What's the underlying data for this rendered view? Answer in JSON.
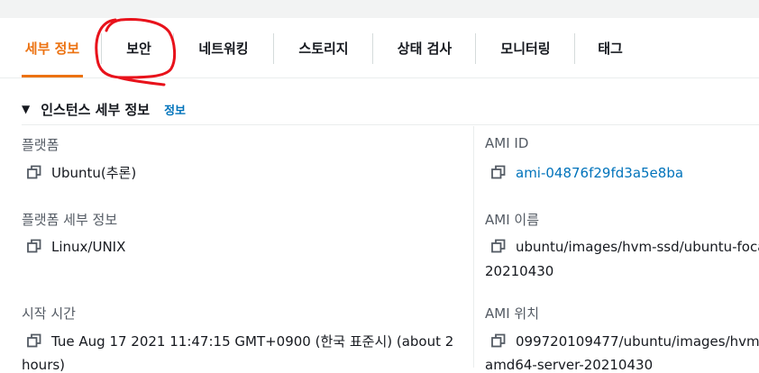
{
  "tabs": [
    {
      "label": "세부 정보",
      "active": true
    },
    {
      "label": "보안",
      "active": false
    },
    {
      "label": "네트워킹",
      "active": false
    },
    {
      "label": "스토리지",
      "active": false
    },
    {
      "label": "상태 검사",
      "active": false
    },
    {
      "label": "모니터링",
      "active": false
    },
    {
      "label": "태그",
      "active": false
    }
  ],
  "section": {
    "caret": "▼",
    "title": "인스턴스 세부 정보",
    "info_link": "정보"
  },
  "left_fields": {
    "platform": {
      "label": "플랫폼",
      "value": "Ubuntu(추론)"
    },
    "platform_details": {
      "label": "플랫폼 세부 정보",
      "value": "Linux/UNIX"
    },
    "launch_time": {
      "label": "시작 시간",
      "value": "Tue Aug 17 2021 11:47:15 GMT+0900 (한국 표준시) (about 2",
      "value_cont": "hours)"
    }
  },
  "right_fields": {
    "ami_id": {
      "label": "AMI ID",
      "value": "ami-04876f29fd3a5e8ba"
    },
    "ami_name": {
      "label": "AMI 이름",
      "value": "ubuntu/images/hvm-ssd/ubuntu-foca",
      "value_cont": "20210430"
    },
    "ami_location": {
      "label": "AMI 위치",
      "value": "099720109477/ubuntu/images/hvm-",
      "value_cont": "amd64-server-20210430"
    }
  },
  "colors": {
    "accent": "#ec7211",
    "link": "#0073bb",
    "annotation": "#e8121b"
  }
}
